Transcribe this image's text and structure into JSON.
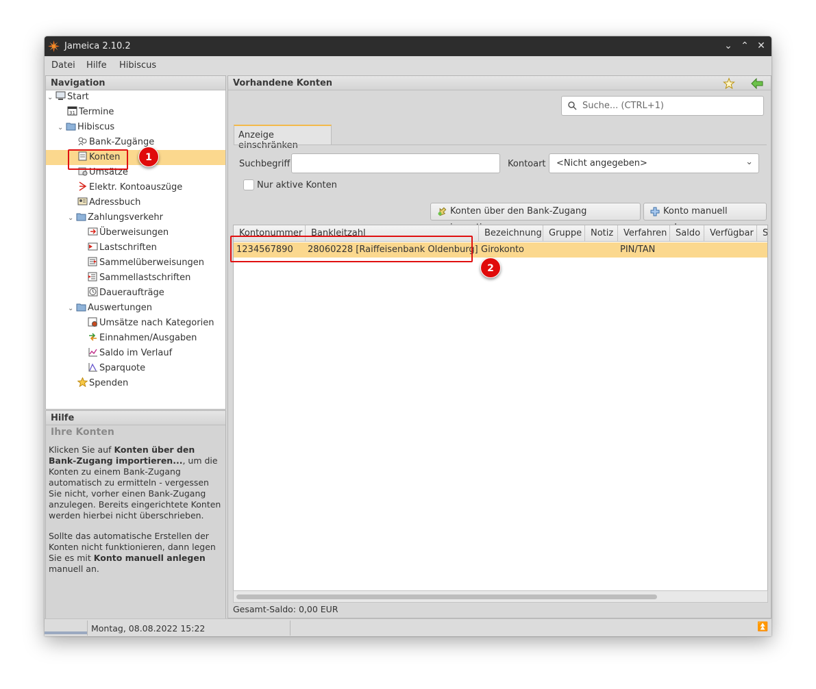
{
  "window": {
    "title": "Jameica 2.10.2"
  },
  "menu": [
    "Datei",
    "Hilfe",
    "Hibiscus"
  ],
  "navigation": {
    "header": "Navigation",
    "items": [
      {
        "label": "Start",
        "icon": "computer-icon"
      },
      {
        "label": "Termine",
        "icon": "calendar-icon"
      },
      {
        "label": "Hibiscus",
        "icon": "folder-icon"
      },
      {
        "label": "Bank-Zugänge",
        "icon": "users-icon"
      },
      {
        "label": "Konten",
        "icon": "account-icon"
      },
      {
        "label": "Umsätze",
        "icon": "transactions-icon"
      },
      {
        "label": "Elektr. Kontoauszüge",
        "icon": "pdf-icon"
      },
      {
        "label": "Adressbuch",
        "icon": "addressbook-icon"
      },
      {
        "label": "Zahlungsverkehr",
        "icon": "folder-icon"
      },
      {
        "label": "Überweisungen",
        "icon": "transfer-icon"
      },
      {
        "label": "Lastschriften",
        "icon": "debit-icon"
      },
      {
        "label": "Sammelüberweisungen",
        "icon": "batch-transfer-icon"
      },
      {
        "label": "Sammellastschriften",
        "icon": "batch-debit-icon"
      },
      {
        "label": "Daueraufträge",
        "icon": "clock-icon"
      },
      {
        "label": "Auswertungen",
        "icon": "folder-icon"
      },
      {
        "label": "Umsätze nach Kategorien",
        "icon": "category-report-icon"
      },
      {
        "label": "Einnahmen/Ausgaben",
        "icon": "income-expense-icon"
      },
      {
        "label": "Saldo im Verlauf",
        "icon": "line-chart-icon"
      },
      {
        "label": "Sparquote",
        "icon": "savings-chart-icon"
      },
      {
        "label": "Spenden",
        "icon": "star-icon"
      }
    ]
  },
  "help": {
    "header": "Hilfe",
    "title": "Ihre Konten",
    "p1_a": " Klicken Sie auf ",
    "p1_b": "Konten über den Bank-Zugang importieren...",
    "p1_c": ", um die Konten zu einem Bank-Zugang automatisch zu ermitteln - vergessen Sie nicht, vorher einen Bank-Zugang anzulegen. Bereits eingerichtete Konten werden hierbei nicht überschrieben.",
    "p2_a": " Sollte das automatische Erstellen der Konten nicht funktionieren, dann legen Sie es mit ",
    "p2_b": "Konto manuell anlegen",
    "p2_c": " manuell an."
  },
  "main": {
    "header": "Vorhandene Konten",
    "search_placeholder": "Suche...  (CTRL+1)",
    "tab": "Anzeige einschränken",
    "suchbegriff_label": "Suchbegriff",
    "kontoart_label": "Kontoart",
    "kontoart_value": "<Nicht angegeben>",
    "only_active_label": "Nur aktive Konten",
    "import_button": "Konten über den Bank-Zugang importieren...",
    "manual_button": "Konto manuell anlegen",
    "columns": [
      "Kontonummer",
      "Bankleitzahl",
      "Bezeichnung",
      "Gruppe",
      "Notiz",
      "Verfahren",
      "Saldo",
      "Verfügbar",
      "S"
    ],
    "rows": [
      {
        "kontonummer": "1234567890",
        "bankleitzahl": "28060228 [Raiffeisenbank Oldenburg]",
        "bezeichnung": "Girokonto",
        "gruppe": "",
        "notiz": "",
        "verfahren": "PIN/TAN",
        "saldo": "",
        "verfuegbar": ""
      }
    ],
    "total": "Gesamt-Saldo: 0,00 EUR"
  },
  "status": {
    "datetime": "Montag, 08.08.2022 15:22"
  },
  "annotations": [
    "1",
    "2"
  ],
  "colors": {
    "selection": "#fbd88e",
    "annotation": "#e00b0b",
    "titlebar": "#2d2d2d"
  }
}
